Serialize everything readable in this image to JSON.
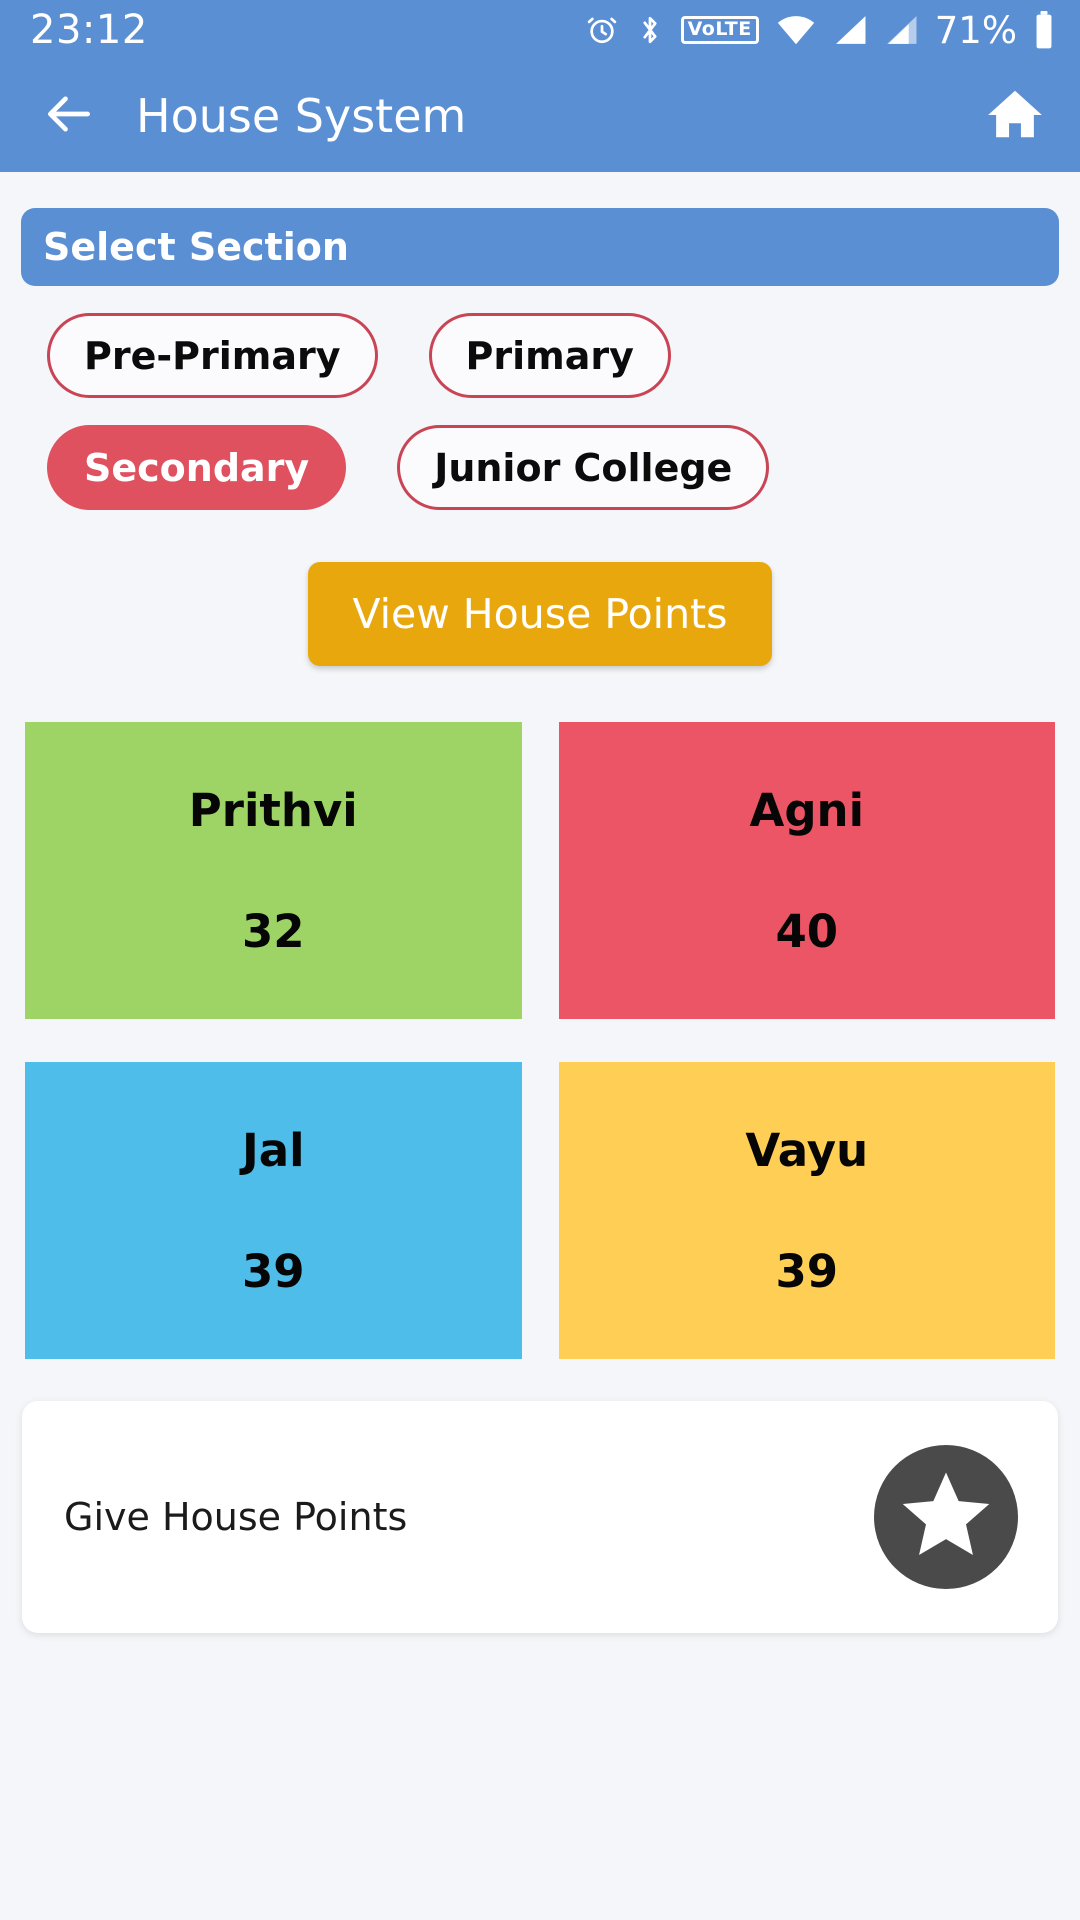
{
  "status_bar": {
    "time": "23:12",
    "battery_percent": "71%",
    "volte_label": "VoLTE",
    "icons": [
      "alarm-icon",
      "bluetooth-icon",
      "volte-icon",
      "wifi-icon",
      "signal-1-icon",
      "signal-2-icon",
      "battery-icon"
    ]
  },
  "app_bar": {
    "title": "House System",
    "back_icon": "back-arrow-icon",
    "home_icon": "home-icon"
  },
  "section_selector": {
    "header_label": "Select Section",
    "options": [
      {
        "label": "Pre-Primary",
        "selected": false
      },
      {
        "label": "Primary",
        "selected": false
      },
      {
        "label": "Secondary",
        "selected": true
      },
      {
        "label": "Junior College",
        "selected": false
      }
    ]
  },
  "view_button": {
    "label": "View House Points"
  },
  "houses": [
    {
      "name": "Prithvi",
      "points": "32",
      "color": "#9DD465"
    },
    {
      "name": "Agni",
      "points": "40",
      "color": "#EC5565"
    },
    {
      "name": "Jal",
      "points": "39",
      "color": "#4FBDEA"
    },
    {
      "name": "Vayu",
      "points": "39",
      "color": "#FFCE55"
    }
  ],
  "give_points": {
    "label": "Give House Points",
    "icon": "star-icon",
    "icon_bg": "#4A4A4A"
  },
  "theme": {
    "primary_blue": "#5B8FD4",
    "accent_red": "#E0515F",
    "chip_border": "#C94455",
    "amber": "#E9A70E",
    "page_bg": "#F4F6F9"
  }
}
